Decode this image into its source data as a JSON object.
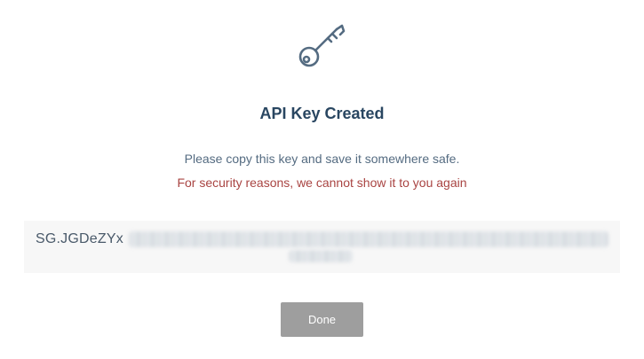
{
  "dialog": {
    "icon": "key-icon",
    "title": "API Key Created",
    "subtitle": "Please copy this key and save it somewhere safe.",
    "warning": "For security reasons, we cannot show it to you again",
    "api_key_visible": "SG.JGDeZYx",
    "done_label": "Done"
  },
  "colors": {
    "title": "#294661",
    "subtitle": "#546b81",
    "warning": "#a94442",
    "key_box_background": "#f7f7f7",
    "button_background": "#9e9e9e",
    "button_text": "#ffffff"
  }
}
